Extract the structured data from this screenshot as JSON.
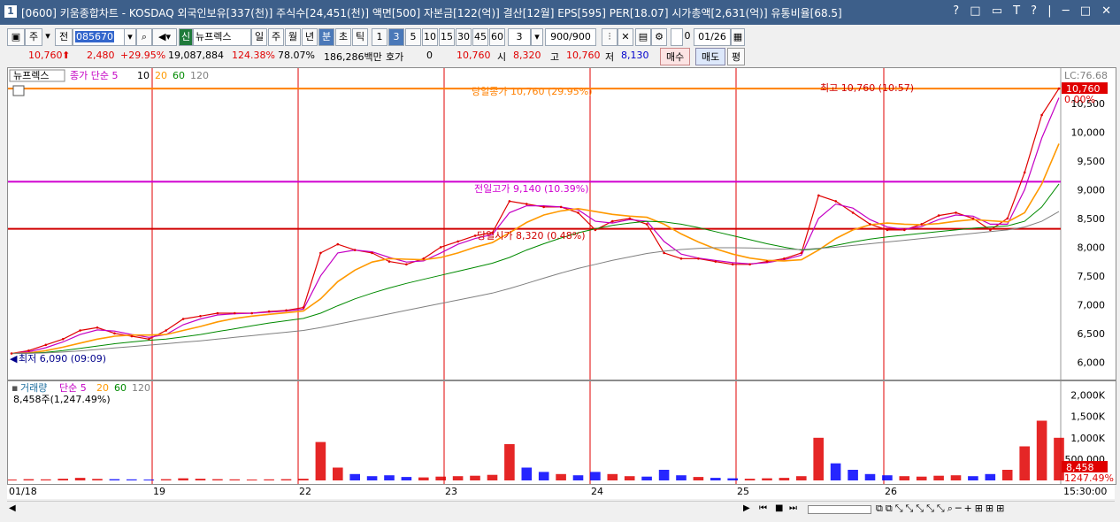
{
  "window": {
    "number": "1",
    "title": "[0600] 키움종합차트 - KOSDAQ 외국인보유[337(천)] 주식수[24,451(천)] 액면[500] 자본금[122(억)] 결산[12월] EPS[595] PER[18.07] 시가총액[2,631(억)] 유통비율[68.5]",
    "controls": "? □ ▭ T ? | ─ □ ✕"
  },
  "toolbar": {
    "market_toggle": "주",
    "prev_label": "전",
    "code": "085670",
    "stock_name": "뉴프렉스",
    "period_buttons": [
      "일",
      "주",
      "월",
      "년",
      "분",
      "초",
      "틱"
    ],
    "active_period": "분",
    "interval_buttons": [
      "1",
      "3",
      "5",
      "10",
      "15",
      "30",
      "45",
      "60"
    ],
    "active_interval": "3",
    "interval_value": "3",
    "count_value": "900/900",
    "date_value": "01/26",
    "date_check_label": "0"
  },
  "quote": {
    "price": "10,760",
    "change": "2,480",
    "change_rate": "+29.95%",
    "volume": "19,087,884",
    "volume_rate": "124.38%",
    "turnover": "78.07%",
    "amount": "186,286백만",
    "hoga_label": "호가",
    "hoga_value": "0",
    "hoga_price": "10,760",
    "open_label": "시",
    "open": "8,320",
    "high_label": "고",
    "high": "10,760",
    "low_label": "저",
    "low": "8,130",
    "buy_button": "매수",
    "sell_button": "매도",
    "avg_button": "평"
  },
  "price_panel": {
    "name_tag": "뉴프렉스",
    "ma_label": "종가 단순 5",
    "ma_periods": [
      "10",
      "20",
      "60",
      "120"
    ],
    "annotations": {
      "close": "당일종가 10,760 (29.95%)",
      "prev_high": "전일고가 9,140 (10.39%)",
      "open": "당일시가 8,320 (0.48%)",
      "high": "최고 10,760 (10:57)",
      "low": "최저 6,090 (09:09)"
    },
    "right_labels": {
      "lc": "LC:76.68",
      "price": "10,760",
      "pct": "0.00%"
    }
  },
  "volume_panel": {
    "label": "거래량",
    "ma_label": "단순 5",
    "ma_periods": [
      "20",
      "60",
      "120"
    ],
    "value_text": "8,458주(1,247.49%)",
    "right_value": "8,458",
    "right_pct": "1247.49%"
  },
  "colors": {
    "title_bg": "#3d5f8a",
    "ma5": "#c400c4",
    "ma10": "#000000",
    "ma20": "#ff9900",
    "ma60": "#008a00",
    "ma120": "#808080",
    "up": "#e00000",
    "down": "#0000ff",
    "close_line": "#ff8000",
    "prev_high_line": "#d000d0",
    "open_line": "#d00000",
    "date_line": "#e00000"
  },
  "chart_data": {
    "type": "line",
    "title": "키움종합차트 뉴프렉스 3분봉",
    "x_dates": [
      "01/18",
      "19",
      "22",
      "23",
      "24",
      "25",
      "26"
    ],
    "time_label": "15:30:00",
    "price_axis": {
      "ticks": [
        6000,
        6500,
        7000,
        7500,
        8000,
        8500,
        9000,
        9500,
        10000,
        10500
      ],
      "ylim": [
        5850,
        10900
      ]
    },
    "series": [
      {
        "name": "종가",
        "values": [
          6150,
          6200,
          6300,
          6400,
          6550,
          6600,
          6500,
          6450,
          6400,
          6550,
          6750,
          6800,
          6850,
          6850,
          6850,
          6880,
          6900,
          6950,
          7900,
          8050,
          7950,
          7900,
          7750,
          7700,
          7800,
          8000,
          8100,
          8200,
          8250,
          8800,
          8750,
          8700,
          8700,
          8600,
          8300,
          8450,
          8500,
          8400,
          7900,
          7800,
          7800,
          7750,
          7700,
          7700,
          7750,
          7800,
          7900,
          8900,
          8800,
          8600,
          8400,
          8300,
          8300,
          8400,
          8550,
          8600,
          8500,
          8300,
          8500,
          9300,
          10300,
          10760
        ]
      },
      {
        "name": "5",
        "values": [
          6150,
          6180,
          6250,
          6350,
          6480,
          6560,
          6540,
          6480,
          6430,
          6480,
          6650,
          6750,
          6820,
          6840,
          6850,
          6870,
          6890,
          6920,
          7500,
          7900,
          7950,
          7920,
          7820,
          7740,
          7760,
          7900,
          8050,
          8150,
          8220,
          8600,
          8720,
          8720,
          8700,
          8650,
          8450,
          8420,
          8480,
          8450,
          8100,
          7880,
          7810,
          7770,
          7730,
          7710,
          7730,
          7780,
          7860,
          8500,
          8750,
          8680,
          8480,
          8350,
          8310,
          8360,
          8480,
          8560,
          8540,
          8400,
          8400,
          9000,
          9900,
          10600
        ]
      },
      {
        "name": "20",
        "values": [
          6150,
          6160,
          6200,
          6260,
          6330,
          6400,
          6450,
          6470,
          6470,
          6480,
          6550,
          6620,
          6700,
          6760,
          6800,
          6830,
          6860,
          6890,
          7100,
          7400,
          7600,
          7740,
          7800,
          7790,
          7780,
          7820,
          7900,
          8000,
          8080,
          8250,
          8430,
          8560,
          8630,
          8670,
          8620,
          8570,
          8540,
          8520,
          8400,
          8230,
          8090,
          7970,
          7880,
          7810,
          7770,
          7760,
          7780,
          7950,
          8150,
          8300,
          8390,
          8420,
          8400,
          8390,
          8410,
          8450,
          8480,
          8460,
          8440,
          8600,
          9100,
          9800
        ]
      },
      {
        "name": "60",
        "values": [
          6150,
          6155,
          6170,
          6200,
          6240,
          6280,
          6320,
          6350,
          6380,
          6400,
          6440,
          6480,
          6530,
          6580,
          6630,
          6680,
          6720,
          6760,
          6850,
          6980,
          7100,
          7200,
          7290,
          7370,
          7440,
          7510,
          7580,
          7650,
          7720,
          7820,
          7950,
          8060,
          8160,
          8250,
          8320,
          8380,
          8420,
          8450,
          8440,
          8400,
          8340,
          8270,
          8200,
          8130,
          8060,
          8000,
          7950,
          7970,
          8030,
          8090,
          8140,
          8180,
          8210,
          8240,
          8270,
          8300,
          8330,
          8350,
          8370,
          8450,
          8700,
          9100
        ]
      },
      {
        "name": "120",
        "values": [
          6150,
          6152,
          6160,
          6175,
          6195,
          6220,
          6245,
          6270,
          6295,
          6320,
          6345,
          6370,
          6400,
          6430,
          6460,
          6490,
          6520,
          6550,
          6600,
          6660,
          6720,
          6780,
          6840,
          6900,
          6960,
          7020,
          7080,
          7140,
          7200,
          7280,
          7370,
          7460,
          7550,
          7630,
          7700,
          7770,
          7830,
          7890,
          7930,
          7960,
          7980,
          7990,
          7990,
          7985,
          7975,
          7965,
          7960,
          7980,
          8000,
          8030,
          8060,
          8090,
          8120,
          8150,
          8180,
          8210,
          8240,
          8270,
          8300,
          8350,
          8450,
          8620
        ]
      }
    ],
    "volume_axis": {
      "ticks": [
        "500,000",
        "1,000K",
        "1,500K",
        "2,000K"
      ],
      "ylim": [
        0,
        2200000
      ]
    },
    "volume": [
      20000,
      30000,
      25000,
      40000,
      60000,
      35000,
      30000,
      25000,
      20000,
      30000,
      50000,
      40000,
      30000,
      25000,
      20000,
      25000,
      30000,
      40000,
      900000,
      300000,
      150000,
      100000,
      120000,
      80000,
      70000,
      90000,
      100000,
      110000,
      130000,
      850000,
      300000,
      200000,
      150000,
      120000,
      200000,
      150000,
      100000,
      90000,
      250000,
      120000,
      80000,
      60000,
      50000,
      40000,
      50000,
      60000,
      100000,
      1000000,
      400000,
      250000,
      150000,
      120000,
      100000,
      90000,
      110000,
      120000,
      100000,
      150000,
      250000,
      800000,
      1400000,
      1000000
    ]
  }
}
